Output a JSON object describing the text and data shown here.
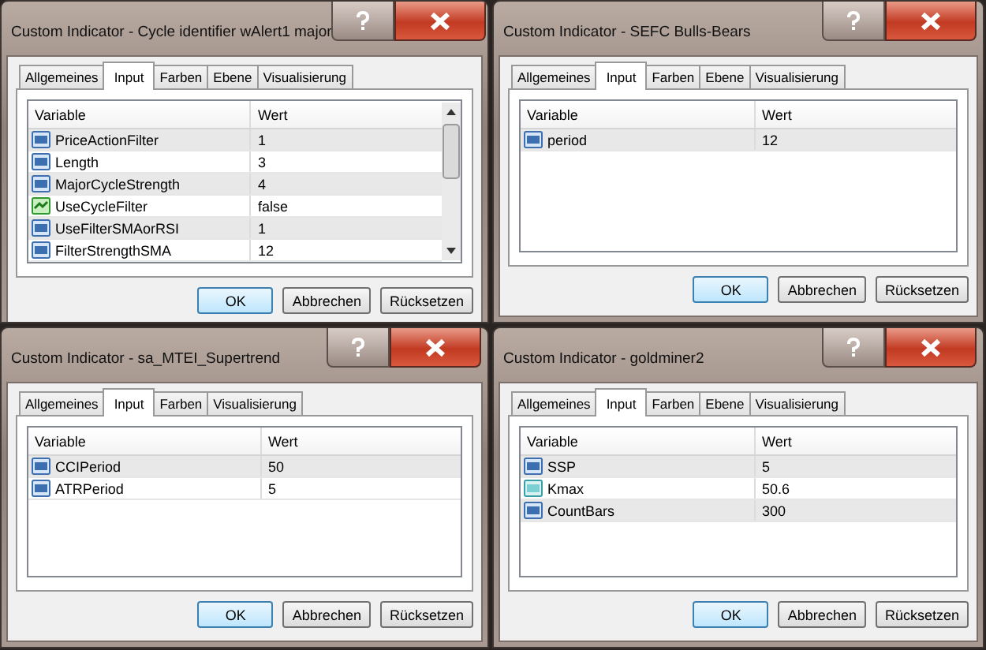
{
  "dialogs": [
    {
      "title": "Custom Indicator - Cycle identifier wAlert1 major",
      "scrollbar": true,
      "tabs": [
        {
          "label": "Allgemeines",
          "selected": false
        },
        {
          "label": "Input",
          "selected": true
        },
        {
          "label": "Farben",
          "selected": false
        },
        {
          "label": "Ebene",
          "selected": false
        },
        {
          "label": "Visualisierung",
          "selected": false
        }
      ],
      "columns": [
        "Variable",
        "Wert"
      ],
      "rows": [
        {
          "kind": "int",
          "variable": "PriceActionFilter",
          "value": "1"
        },
        {
          "kind": "int",
          "variable": "Length",
          "value": "3"
        },
        {
          "kind": "int",
          "variable": "MajorCycleStrength",
          "value": "4"
        },
        {
          "kind": "bool",
          "variable": "UseCycleFilter",
          "value": "false"
        },
        {
          "kind": "int",
          "variable": "UseFilterSMAorRSI",
          "value": "1"
        },
        {
          "kind": "int",
          "variable": "FilterStrengthSMA",
          "value": "12"
        }
      ],
      "buttons": [
        "OK",
        "Abbrechen",
        "Rücksetzen"
      ]
    },
    {
      "title": "Custom Indicator - SEFC Bulls-Bears",
      "scrollbar": false,
      "tabs": [
        {
          "label": "Allgemeines",
          "selected": false
        },
        {
          "label": "Input",
          "selected": true
        },
        {
          "label": "Farben",
          "selected": false
        },
        {
          "label": "Ebene",
          "selected": false
        },
        {
          "label": "Visualisierung",
          "selected": false
        }
      ],
      "columns": [
        "Variable",
        "Wert"
      ],
      "rows": [
        {
          "kind": "int",
          "variable": "period",
          "value": "12"
        }
      ],
      "buttons": [
        "OK",
        "Abbrechen",
        "Rücksetzen"
      ]
    },
    {
      "title": "Custom Indicator - sa_MTEI_Supertrend",
      "scrollbar": false,
      "tabs": [
        {
          "label": "Allgemeines",
          "selected": false
        },
        {
          "label": "Input",
          "selected": true
        },
        {
          "label": "Farben",
          "selected": false
        },
        {
          "label": "Visualisierung",
          "selected": false
        }
      ],
      "columns": [
        "Variable",
        "Wert"
      ],
      "rows": [
        {
          "kind": "int",
          "variable": "CCIPeriod",
          "value": "50"
        },
        {
          "kind": "int",
          "variable": "ATRPeriod",
          "value": "5"
        }
      ],
      "buttons": [
        "OK",
        "Abbrechen",
        "Rücksetzen"
      ]
    },
    {
      "title": "Custom Indicator - goldminer2",
      "scrollbar": false,
      "tabs": [
        {
          "label": "Allgemeines",
          "selected": false
        },
        {
          "label": "Input",
          "selected": true
        },
        {
          "label": "Farben",
          "selected": false
        },
        {
          "label": "Ebene",
          "selected": false
        },
        {
          "label": "Visualisierung",
          "selected": false
        }
      ],
      "columns": [
        "Variable",
        "Wert"
      ],
      "rows": [
        {
          "kind": "int",
          "variable": "SSP",
          "value": "5"
        },
        {
          "kind": "double",
          "variable": "Kmax",
          "value": "50.6"
        },
        {
          "kind": "int",
          "variable": "CountBars",
          "value": "300"
        }
      ],
      "buttons": [
        "OK",
        "Abbrechen",
        "Rücksetzen"
      ]
    }
  ]
}
